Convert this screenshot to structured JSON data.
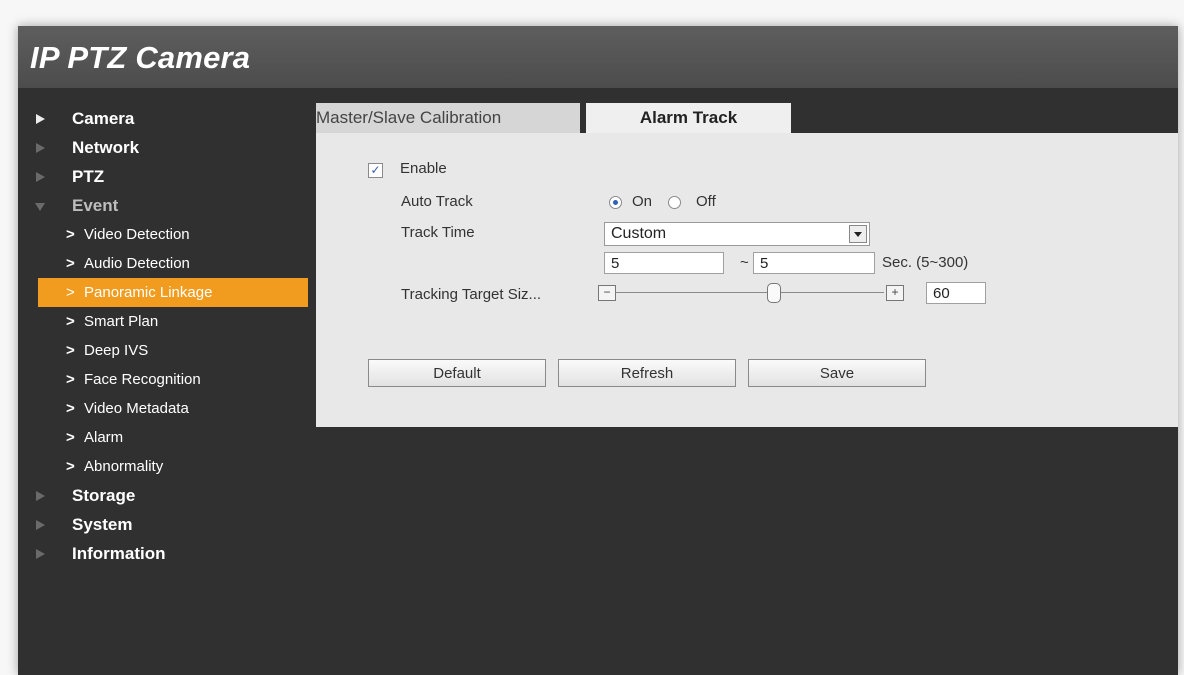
{
  "app": {
    "title": "IP PTZ Camera"
  },
  "sidebar": {
    "items": [
      {
        "label": "Camera"
      },
      {
        "label": "Network"
      },
      {
        "label": "PTZ"
      },
      {
        "label": "Event"
      },
      {
        "label": "Storage"
      },
      {
        "label": "System"
      },
      {
        "label": "Information"
      }
    ],
    "event_subitems": [
      {
        "label": "Video Detection"
      },
      {
        "label": "Audio Detection"
      },
      {
        "label": "Panoramic Linkage",
        "active": true
      },
      {
        "label": "Smart Plan"
      },
      {
        "label": "Deep IVS"
      },
      {
        "label": "Face Recognition"
      },
      {
        "label": "Video Metadata"
      },
      {
        "label": "Alarm"
      },
      {
        "label": "Abnormality"
      }
    ],
    "active_color": "#f29c1f"
  },
  "tabs": [
    {
      "label": "Master/Slave Calibration",
      "active": false
    },
    {
      "label": "Alarm Track",
      "active": true
    }
  ],
  "form": {
    "enable": {
      "label": "Enable",
      "checked": true
    },
    "auto_track": {
      "label": "Auto Track",
      "options": [
        "On",
        "Off"
      ],
      "selected": "On"
    },
    "track_time": {
      "label": "Track Time",
      "selected": "Custom",
      "from": "5",
      "tilde": "~",
      "to": "5",
      "unit": "Sec. (5~300)"
    },
    "tracking_target_size": {
      "label": "Tracking Target Siz...",
      "minus": "−",
      "plus": "+",
      "value": "60"
    }
  },
  "buttons": {
    "default": "Default",
    "refresh": "Refresh",
    "save": "Save"
  }
}
